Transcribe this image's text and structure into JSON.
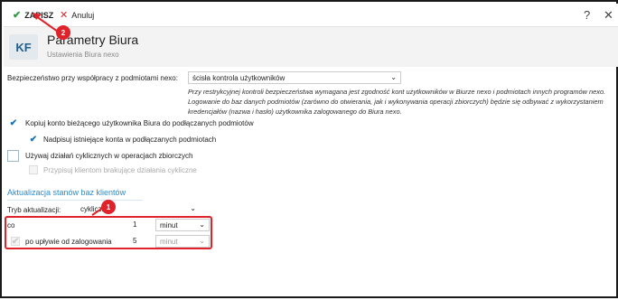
{
  "toolbar": {
    "save_label": "ZAPISZ",
    "cancel_label": "Anuluj",
    "help_label": "?",
    "close_label": "✕"
  },
  "header": {
    "logo_text": "KF",
    "title": "Parametry Biura",
    "subtitle": "Ustawienia Biura nexo"
  },
  "security": {
    "label": "Bezpieczeństwo przy współpracy z podmiotami nexo:",
    "value": "ścisła kontrola użytkowników",
    "note": "Przy restrykcyjnej kontroli bezpieczeństwa wymagana jest zgodność kont użytkowników w Biurze nexo i podmiotach innych programów nexo. Logowanie do baz danych podmiotów (zarówno do otwierania, jak i wykonywania operacji zbiorczych) będzie się odbywać z wykorzystaniem kredencjałów (nazwa i hasło) użytkownika zalogowanego do Biura nexo."
  },
  "options": {
    "copy_account": {
      "label": "Kopiuj konto bieżącego użytkownika Biura do podłączanych podmiotów",
      "checked": true
    },
    "overwrite_accounts": {
      "label": "Nadpisuj istniejące konta w podłączanych podmiotach",
      "checked": true
    },
    "use_cyclic": {
      "label": "Używaj działań cyklicznych w operacjach zbiorczych",
      "checked": false
    },
    "assign_cyclic": {
      "label": "Przypisuj klientom brakujące działania cykliczne",
      "checked": false
    }
  },
  "update": {
    "section_title": "Aktualizacja stanów baz klientów",
    "mode_label": "Tryb aktualizacji:",
    "mode_value": "cykliczna",
    "row1": {
      "label": "co",
      "number": "1",
      "unit": "minut"
    },
    "row2": {
      "label": "po upływie od zalogowania",
      "number": "5",
      "unit": "minut"
    }
  },
  "annotations": {
    "badge1": "1",
    "badge2": "2",
    "accent_color": "#e0222a"
  }
}
